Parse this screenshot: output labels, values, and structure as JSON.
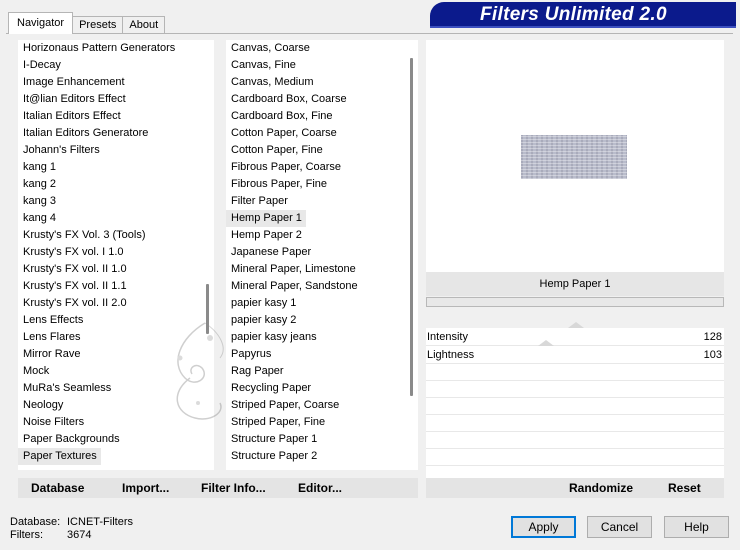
{
  "tabs": [
    {
      "label": "Navigator",
      "active": true
    },
    {
      "label": "Presets",
      "active": false
    },
    {
      "label": "About",
      "active": false
    }
  ],
  "title": "Filters Unlimited 2.0",
  "categories": {
    "items": [
      "Horizonaus Pattern Generators",
      "I-Decay",
      "Image Enhancement",
      "It@lian Editors Effect",
      "Italian Editors Effect",
      "Italian Editors Generatore",
      "Johann's Filters",
      "kang 1",
      "kang 2",
      "kang 3",
      "kang 4",
      "Krusty's FX Vol. 3 (Tools)",
      "Krusty's FX vol. I 1.0",
      "Krusty's FX vol. II 1.0",
      "Krusty's FX vol. II 1.1",
      "Krusty's FX vol. II 2.0",
      "Lens Effects",
      "Lens Flares",
      "Mirror Rave",
      "Mock",
      "MuRa's Seamless",
      "Neology",
      "Noise Filters",
      "Paper Backgrounds",
      "Paper Textures"
    ],
    "selected": "Paper Textures"
  },
  "filters": {
    "items": [
      "Canvas, Coarse",
      "Canvas, Fine",
      "Canvas, Medium",
      "Cardboard Box, Coarse",
      "Cardboard Box, Fine",
      "Cotton Paper, Coarse",
      "Cotton Paper, Fine",
      "Fibrous Paper, Coarse",
      "Fibrous Paper, Fine",
      "Filter Paper",
      "Hemp Paper 1",
      "Hemp Paper 2",
      "Japanese Paper",
      "Mineral Paper, Limestone",
      "Mineral Paper, Sandstone",
      "papier kasy 1",
      "papier kasy 2",
      "papier kasy jeans",
      "Papyrus",
      "Rag Paper",
      "Recycling Paper",
      "Striped Paper, Coarse",
      "Striped Paper, Fine",
      "Structure Paper 1",
      "Structure Paper 2"
    ],
    "selected": "Hemp Paper 1"
  },
  "preview": {
    "filter_name": "Hemp Paper 1",
    "params": [
      {
        "name": "Intensity",
        "value": "128",
        "level": 128
      },
      {
        "name": "Lightness",
        "value": "103",
        "level": 103
      }
    ]
  },
  "left_buttons": {
    "database": "Database",
    "import": "Import...",
    "filter_info": "Filter Info...",
    "editor": "Editor..."
  },
  "right_buttons": {
    "randomize": "Randomize",
    "reset": "Reset"
  },
  "status": {
    "database_label": "Database:",
    "database_value": "ICNET-Filters",
    "filters_label": "Filters:",
    "filters_value": "3674"
  },
  "dialog": {
    "apply": "Apply",
    "cancel": "Cancel",
    "help": "Help"
  },
  "colors": {
    "banner": "#0b1a8c",
    "selection": "#e8e8e8",
    "default_button_border": "#0078d7"
  }
}
